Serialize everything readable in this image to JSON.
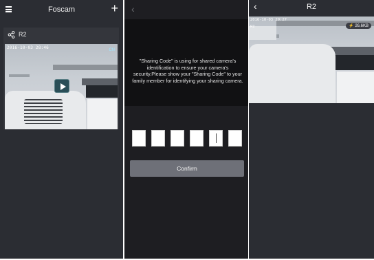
{
  "panel1": {
    "title": "Foscam",
    "menu_icon": "hamburger-menu-icon",
    "add_icon": "plus-icon",
    "camera": {
      "name": "R2",
      "share_icon": "share-icon",
      "timestamp": "2016-10-03 28:46",
      "corner_label": "CN",
      "play_icon": "play-icon"
    }
  },
  "panel2": {
    "back_icon": "chevron-left-icon",
    "info_text": "\"Sharing Code\" is using for shared camera's identification to ensure your camera's security.Please show your \"Sharing Code\" to your family member for identifying your sharing camera.",
    "code_boxes": [
      "",
      "",
      "",
      "",
      "",
      ""
    ],
    "confirm_label": "Confirm"
  },
  "panel3": {
    "title": "R2",
    "back_icon": "chevron-left-icon",
    "timestamp": "2016-10-03 29:27",
    "side_label": "R2",
    "speed": "26.6KB",
    "speed_icon": "bolt-icon"
  },
  "colors": {
    "panel_bg": "#2b2d33",
    "card_bg": "#34363c",
    "confirm_bg": "#6e7078",
    "play_bg": "#2a4e57"
  }
}
